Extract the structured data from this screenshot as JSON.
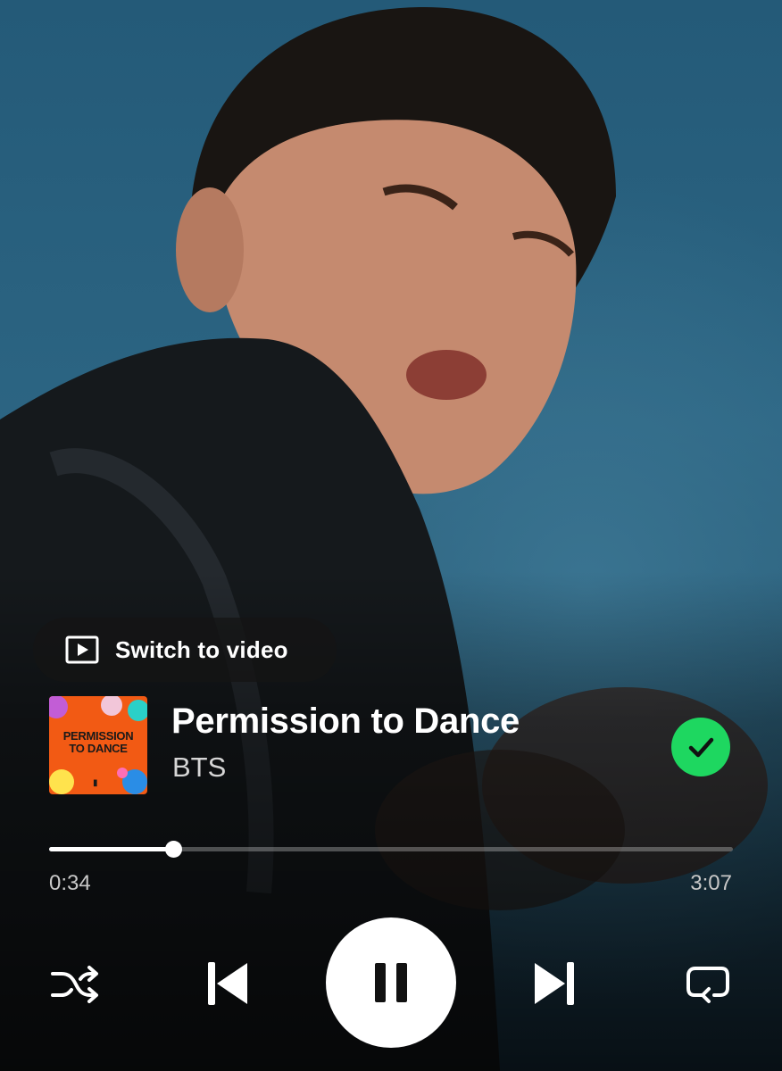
{
  "player": {
    "switch_to_video_label": "Switch to video",
    "track": {
      "title": "Permission to Dance",
      "artist": "BTS",
      "cover_text_line1": "PERMISSION",
      "cover_text_line2": "TO DANCE",
      "cover_color": "#f25a14",
      "liked": true
    },
    "progress": {
      "elapsed": "0:34",
      "total": "3:07",
      "fraction": 0.1818
    },
    "controls": {
      "shuffle_icon": "shuffle-icon",
      "previous_icon": "skip-previous-icon",
      "play_pause_icon": "pause-icon",
      "next_icon": "skip-next-icon",
      "repeat_icon": "repeat-icon"
    },
    "colors": {
      "accent_green": "#1ed760",
      "text_primary": "#ffffff",
      "text_secondary": "#c8c8c8"
    }
  }
}
